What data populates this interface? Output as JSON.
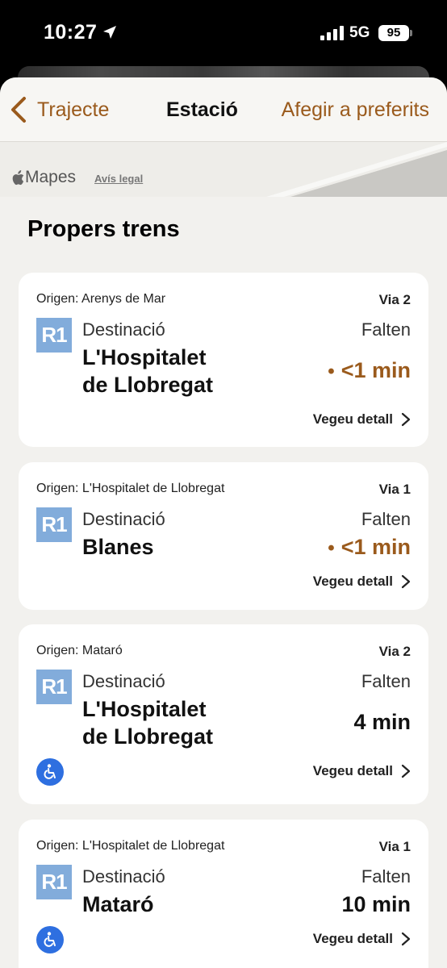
{
  "status_bar": {
    "time": "10:27",
    "network": "5G",
    "battery": "95"
  },
  "navbar": {
    "back_label": "Trajecte",
    "title": "Estació",
    "favorite_label": "Afegir a preferits"
  },
  "map": {
    "logo_text": "Mapes",
    "legal_label": "Avís legal"
  },
  "section_title": "Propers trens",
  "colors": {
    "accent": "#9a5a1c",
    "line_r1": "#82acdb",
    "accessibility": "#2e6fe0"
  },
  "trains": [
    {
      "origin": "Origen: Arenys de Mar",
      "platform": "Via 2",
      "line": "R1",
      "destination_label": "Destinació",
      "destination": "L'Hospitalet\nde Llobregat",
      "remaining_label": "Falten",
      "eta": "<1 min",
      "imminent": true,
      "accessible": false,
      "detail_label": "Vegeu detall"
    },
    {
      "origin": "Origen: L'Hospitalet de Llobregat",
      "platform": "Via 1",
      "line": "R1",
      "destination_label": "Destinació",
      "destination": "Blanes",
      "remaining_label": "Falten",
      "eta": "<1 min",
      "imminent": true,
      "accessible": false,
      "detail_label": "Vegeu detall"
    },
    {
      "origin": "Origen: Mataró",
      "platform": "Via 2",
      "line": "R1",
      "destination_label": "Destinació",
      "destination": "L'Hospitalet\nde Llobregat",
      "remaining_label": "Falten",
      "eta": "4 min",
      "imminent": false,
      "accessible": true,
      "detail_label": "Vegeu detall"
    },
    {
      "origin": "Origen: L'Hospitalet de Llobregat",
      "platform": "Via 1",
      "line": "R1",
      "destination_label": "Destinació",
      "destination": "Mataró",
      "remaining_label": "Falten",
      "eta": "10 min",
      "imminent": false,
      "accessible": true,
      "detail_label": "Vegeu detall"
    }
  ]
}
